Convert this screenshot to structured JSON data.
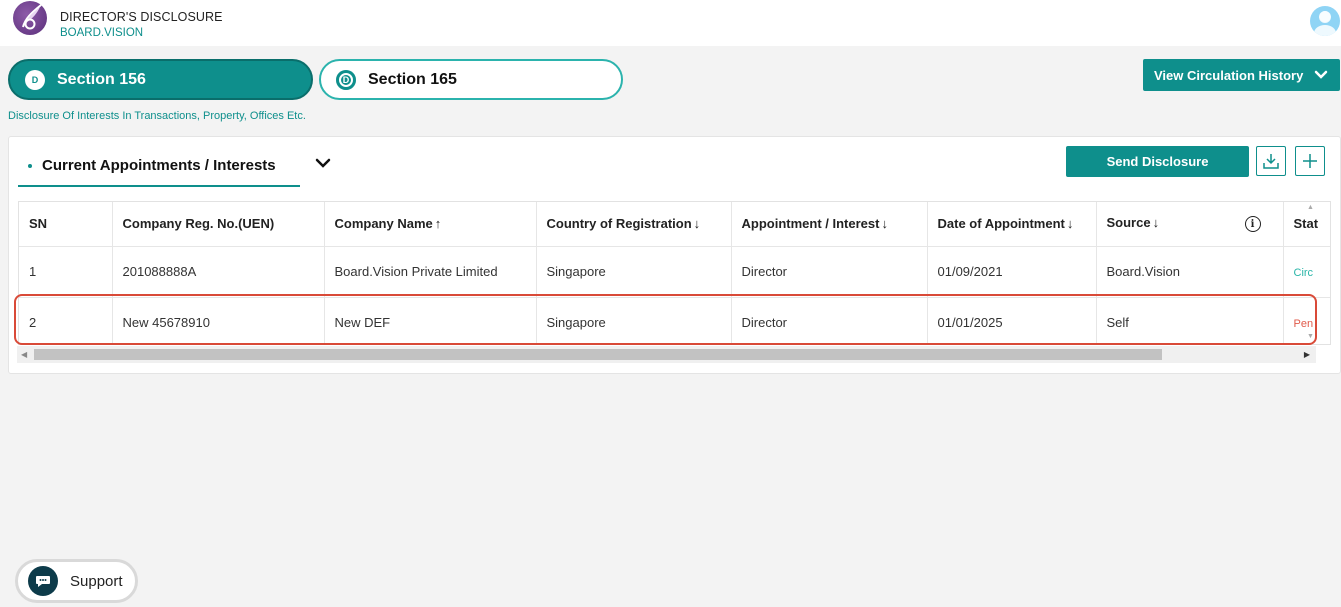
{
  "header": {
    "app_title": "DIRECTOR'S DISCLOSURE",
    "app_subtitle": "BOARD.VISION",
    "logo_icon": "feather-logo-icon",
    "avatar_icon": "user-avatar-icon"
  },
  "sections": {
    "tabs": [
      {
        "badge": "D",
        "label": "Section 156",
        "active": true
      },
      {
        "badge": "D",
        "label": "Section 165",
        "active": false
      }
    ],
    "description": "Disclosure Of Interests In Transactions, Property, Offices Etc."
  },
  "view_history": {
    "label": "View Circulation History",
    "icon": "chevron-down-icon"
  },
  "card": {
    "tab_label": "Current Appointments / Interests",
    "send_label": "Send Disclosure",
    "download_icon": "download-icon",
    "add_icon": "plus-icon"
  },
  "table": {
    "columns": [
      {
        "label": "SN",
        "arrow": ""
      },
      {
        "label": "Company Reg. No.(UEN)",
        "arrow": ""
      },
      {
        "label": "Company Name",
        "arrow": "↑"
      },
      {
        "label": "Country of Registration",
        "arrow": "↓"
      },
      {
        "label": "Appointment / Interest",
        "arrow": "↓"
      },
      {
        "label": "Date of Appointment",
        "arrow": "↓"
      },
      {
        "label": "Source",
        "arrow": "↓"
      },
      {
        "label": "Stat",
        "arrow": ""
      }
    ],
    "info_icon_text": "i",
    "rows": [
      {
        "sn": "1",
        "uen": "201088888A",
        "company": "Board.Vision Private Limited",
        "country": "Singapore",
        "appointment": "Director",
        "date": "01/09/2021",
        "source": "Board.Vision",
        "status": "Circ"
      },
      {
        "sn": "2",
        "uen": "New 45678910",
        "company": "New DEF",
        "country": "Singapore",
        "appointment": "Director",
        "date": "01/01/2025",
        "source": "Self",
        "status": "Pen"
      }
    ]
  },
  "support": {
    "label": "Support",
    "icon": "chat-bubble-icon"
  },
  "colors": {
    "accent": "#0e8f8c",
    "highlight": "#d94a38",
    "status_circulated": "#2ab5a8",
    "status_pending": "#e05a4a"
  }
}
